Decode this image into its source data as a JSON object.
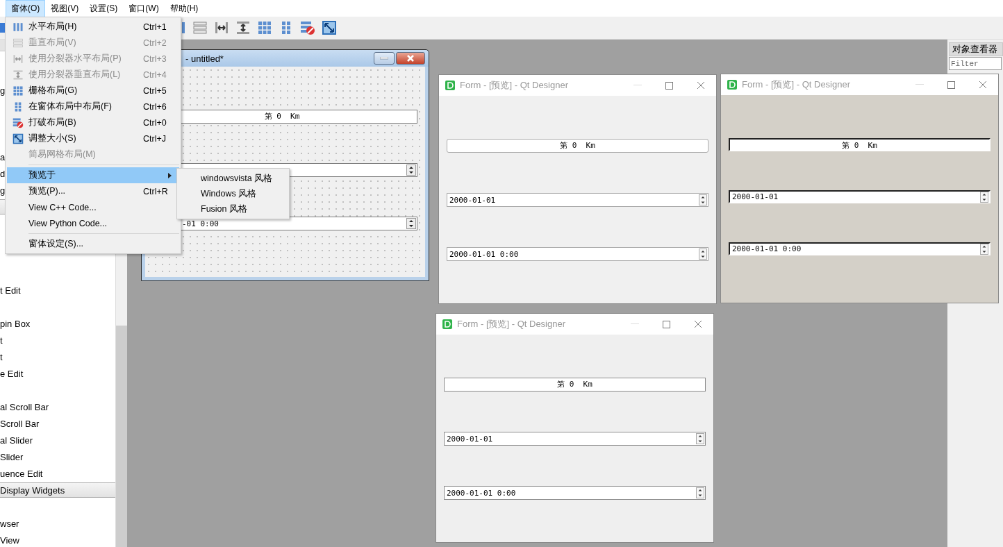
{
  "menu_bar": [
    {
      "label": "窗体(O)",
      "selected": true
    },
    {
      "label": "视图(V)",
      "selected": false
    },
    {
      "label": "设置(S)",
      "selected": false
    },
    {
      "label": "窗口(W)",
      "selected": false
    },
    {
      "label": "帮助(H)",
      "selected": false
    }
  ],
  "widget_box": {
    "rows": [
      {
        "kind": "item",
        "label": "g"
      },
      {
        "kind": "blank"
      },
      {
        "kind": "blank"
      },
      {
        "kind": "blank"
      },
      {
        "kind": "item",
        "label": "a"
      },
      {
        "kind": "item",
        "label": "d"
      },
      {
        "kind": "item",
        "label": "g"
      },
      {
        "kind": "category"
      },
      {
        "kind": "blank"
      },
      {
        "kind": "blank"
      },
      {
        "kind": "blank"
      },
      {
        "kind": "blank"
      },
      {
        "kind": "item",
        "label": "t Edit"
      },
      {
        "kind": "blank"
      },
      {
        "kind": "item",
        "label": "pin Box"
      },
      {
        "kind": "item",
        "label": "t"
      },
      {
        "kind": "item",
        "label": "t"
      },
      {
        "kind": "item",
        "label": "e Edit"
      },
      {
        "kind": "blank"
      },
      {
        "kind": "item",
        "label": "al Scroll Bar"
      },
      {
        "kind": "item",
        "label": "Scroll Bar"
      },
      {
        "kind": "item",
        "label": "al Slider"
      },
      {
        "kind": "item",
        "label": "Slider"
      },
      {
        "kind": "item",
        "label": "uence Edit"
      },
      {
        "kind": "category",
        "label": "Display Widgets"
      },
      {
        "kind": "blank"
      },
      {
        "kind": "item",
        "label": "wser"
      },
      {
        "kind": "item",
        "label": "View"
      }
    ]
  },
  "designer_form": {
    "title": "- untitled*",
    "line_edit": "第 0  Km",
    "date_time_edit": "-01 0:00"
  },
  "preview_windows": [
    {
      "kind": "windowsvista",
      "title": "Form - [预览] - Qt Designer",
      "line_edit": "第 0  Km",
      "date_edit": "2000-01-01",
      "date_time_edit": "2000-01-01 0:00"
    },
    {
      "kind": "windows",
      "title": "Form - [预览] - Qt Designer",
      "line_edit": "第 0  Km",
      "date_edit": "2000-01-01",
      "date_time_edit": "2000-01-01 0:00"
    },
    {
      "kind": "fusion",
      "title": "Form - [预览] - Qt Designer",
      "line_edit": "第 0  Km",
      "date_edit": "2000-01-01",
      "date_time_edit": "2000-01-01 0:00"
    }
  ],
  "object_inspector": {
    "title": "对象查看器",
    "filter_placeholder": "Filter"
  },
  "form_menu": {
    "items": [
      {
        "kind": "action",
        "label": "水平布局(H)",
        "shortcut": "Ctrl+1",
        "disabled": false,
        "selected": false
      },
      {
        "kind": "action",
        "label": "垂直布局(V)",
        "shortcut": "Ctrl+2",
        "disabled": true,
        "selected": false
      },
      {
        "kind": "action",
        "label": "使用分裂器水平布局(P)",
        "shortcut": "Ctrl+3",
        "disabled": true,
        "selected": false
      },
      {
        "kind": "action",
        "label": "使用分裂器垂直布局(L)",
        "shortcut": "Ctrl+4",
        "disabled": true,
        "selected": false
      },
      {
        "kind": "action",
        "label": "栅格布局(G)",
        "shortcut": "Ctrl+5",
        "disabled": false,
        "selected": false
      },
      {
        "kind": "action",
        "label": "在窗体布局中布局(F)",
        "shortcut": "Ctrl+6",
        "disabled": false,
        "selected": false
      },
      {
        "kind": "action",
        "label": "打破布局(B)",
        "shortcut": "Ctrl+0",
        "disabled": false,
        "selected": false
      },
      {
        "kind": "action",
        "label": "调整大小(S)",
        "shortcut": "Ctrl+J",
        "disabled": false,
        "selected": false
      },
      {
        "kind": "action",
        "label": "简易网格布局(M)",
        "disabled": true,
        "selected": false
      },
      {
        "kind": "separator"
      },
      {
        "kind": "submenu",
        "label": "预览于",
        "disabled": false,
        "selected": true
      },
      {
        "kind": "action",
        "label": "预览(P)...",
        "shortcut": "Ctrl+R",
        "disabled": false,
        "selected": false
      },
      {
        "kind": "action",
        "label": "View C++ Code...",
        "disabled": false,
        "selected": false
      },
      {
        "kind": "action",
        "label": "View Python Code...",
        "disabled": false,
        "selected": false
      },
      {
        "kind": "separator"
      },
      {
        "kind": "action",
        "label": "窗体设定(S)...",
        "disabled": false,
        "selected": false
      }
    ]
  },
  "preview_submenu": {
    "items": [
      {
        "label": "windowsvista 风格"
      },
      {
        "label": "Windows 风格"
      },
      {
        "label": "Fusion 风格"
      }
    ]
  }
}
